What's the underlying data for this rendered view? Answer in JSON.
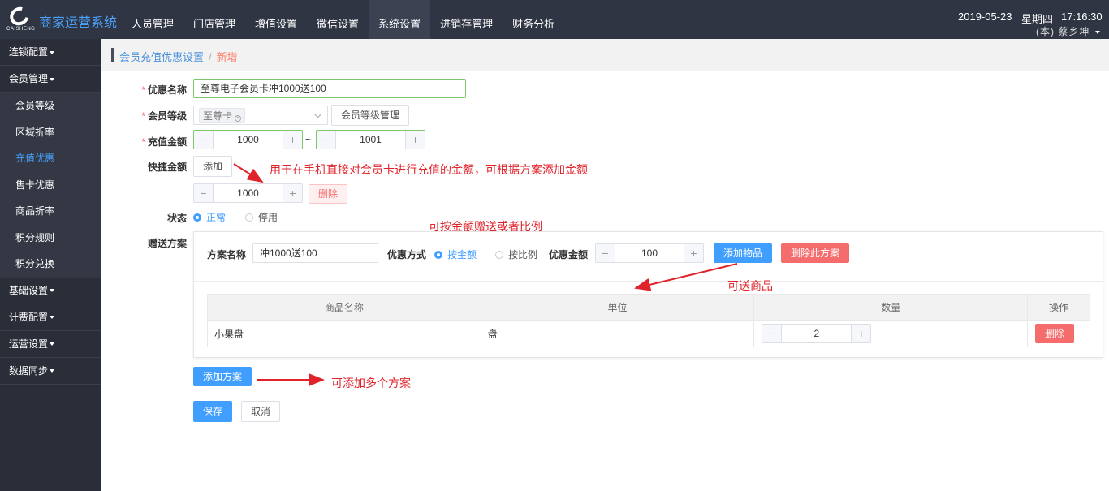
{
  "app": {
    "title": "商家运营系统",
    "logo_sub": "CAISHENG"
  },
  "nav": [
    {
      "label": "人员管理"
    },
    {
      "label": "门店管理"
    },
    {
      "label": "增值设置"
    },
    {
      "label": "微信设置"
    },
    {
      "label": "系统设置",
      "active": true
    },
    {
      "label": "进销存管理"
    },
    {
      "label": "财务分析"
    }
  ],
  "header": {
    "date": "2019-05-23",
    "weekday": "星期四",
    "time": "17:16:30",
    "user_partial": "(本)",
    "user_name_partial": "蔡乡坤"
  },
  "sidebar": {
    "g1": "连锁配置",
    "g2": "会员管理",
    "subs": [
      "会员等级",
      "区域折率",
      "充值优惠",
      "售卡优惠",
      "商品折率",
      "积分规则",
      "积分兑换"
    ],
    "active_sub": "充值优惠",
    "g3": "基础设置",
    "g4": "计费配置",
    "g5": "运营设置",
    "g6": "数据同步"
  },
  "breadcrumb": {
    "parent": "会员充值优惠设置",
    "sep": "/",
    "current": "新增"
  },
  "form": {
    "name_label": "优惠名称",
    "name_value": "至尊电子会员卡冲1000送100",
    "level_label": "会员等级",
    "level_tag": "至尊卡",
    "level_manage_btn": "会员等级管理",
    "amount_label": "充值金额",
    "amount_min": "1000",
    "amount_tilde": "~",
    "amount_max": "1001",
    "quick_label": "快捷金额",
    "quick_add_btn": "添加",
    "quick_value": "1000",
    "quick_delete_btn": "删除",
    "status_label": "状态",
    "status_on": "正常",
    "status_off": "停用",
    "gift_label": "赠送方案"
  },
  "plan": {
    "name_label": "方案名称",
    "name_value": "冲1000送100",
    "mode_label": "优惠方式",
    "mode_amount": "按金额",
    "mode_ratio": "按比例",
    "amount_label": "优惠金额",
    "amount_value": "100",
    "add_goods_btn": "添加物品",
    "delete_plan_btn": "删除此方案",
    "table": {
      "headers": [
        "商品名称",
        "单位",
        "数量",
        "操作"
      ],
      "rows": [
        {
          "name": "小果盘",
          "unit": "盘",
          "qty": "2",
          "action": "删除"
        }
      ]
    }
  },
  "actions": {
    "add_plan": "添加方案",
    "save": "保存",
    "cancel": "取消"
  },
  "annotations": {
    "quick": "用于在手机直接对会员卡进行充值的金额，可根据方案添加金额",
    "ratio": "可按金额赠送或者比例",
    "goods": "可送商品",
    "multi": "可添加多个方案"
  },
  "colors": {
    "topbar": "#303543",
    "sidebar": "#2a2e38",
    "primary": "#409eff",
    "danger": "#f56c6c",
    "annotation": "#e0232b"
  }
}
